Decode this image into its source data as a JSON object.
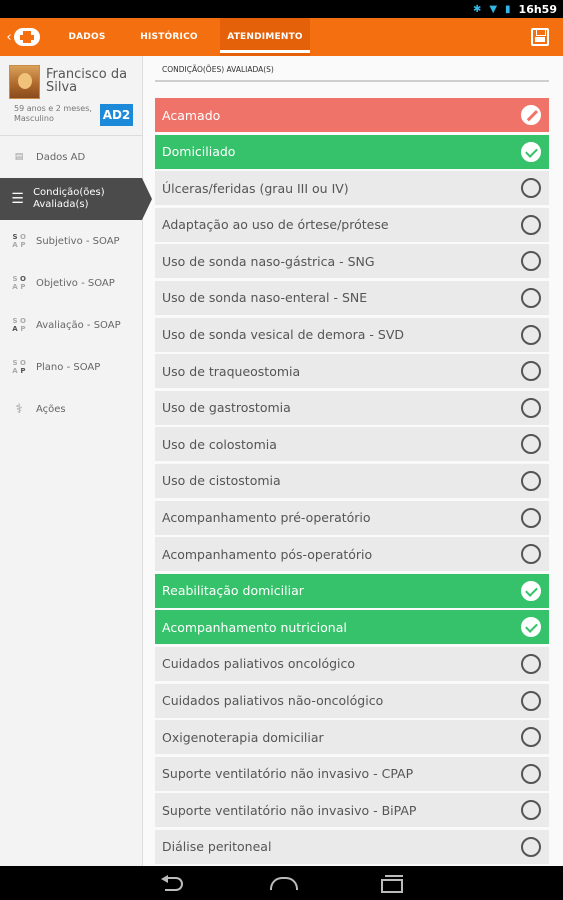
{
  "status_bar": {
    "time": "16h59"
  },
  "tabs": [
    {
      "label": "DADOS"
    },
    {
      "label": "HISTÓRICO"
    },
    {
      "label": "ATENDIMENTO"
    }
  ],
  "patient": {
    "name": "Francisco da Silva",
    "meta": "59 anos e 2 meses, Masculino",
    "badge": "AD2"
  },
  "sidebar": {
    "items": [
      {
        "label": "Dados AD",
        "icon": "id-card-icon"
      },
      {
        "label": "Condição(ões) Avaliada(s)",
        "icon": "list-icon"
      },
      {
        "label": "Subjetivo - SOAP",
        "icon": "soap-s-icon"
      },
      {
        "label": "Objetivo - SOAP",
        "icon": "soap-o-icon"
      },
      {
        "label": "Avaliação - SOAP",
        "icon": "soap-a-icon"
      },
      {
        "label": "Plano - SOAP",
        "icon": "soap-p-icon"
      },
      {
        "label": "Ações",
        "icon": "stethoscope-icon"
      }
    ]
  },
  "main": {
    "section_title": "CONDIÇÃO(ÕES) AVALIADA(S)",
    "conditions": [
      {
        "label": "Acamado",
        "state": "blocked"
      },
      {
        "label": "Domiciliado",
        "state": "checked"
      },
      {
        "label": "Úlceras/feridas (grau III ou IV)",
        "state": "unchecked"
      },
      {
        "label": "Adaptação ao uso de órtese/prótese",
        "state": "unchecked"
      },
      {
        "label": "Uso de sonda naso-gástrica - SNG",
        "state": "unchecked"
      },
      {
        "label": "Uso de sonda naso-enteral - SNE",
        "state": "unchecked"
      },
      {
        "label": "Uso de sonda vesical de demora - SVD",
        "state": "unchecked"
      },
      {
        "label": "Uso de traqueostomia",
        "state": "unchecked"
      },
      {
        "label": "Uso de gastrostomia",
        "state": "unchecked"
      },
      {
        "label": "Uso de colostomia",
        "state": "unchecked"
      },
      {
        "label": "Uso de cistostomia",
        "state": "unchecked"
      },
      {
        "label": "Acompanhamento pré-operatório",
        "state": "unchecked"
      },
      {
        "label": "Acompanhamento pós-operatório",
        "state": "unchecked"
      },
      {
        "label": "Reabilitação domiciliar",
        "state": "checked"
      },
      {
        "label": "Acompanhamento nutricional",
        "state": "checked"
      },
      {
        "label": "Cuidados paliativos oncológico",
        "state": "unchecked"
      },
      {
        "label": "Cuidados paliativos não-oncológico",
        "state": "unchecked"
      },
      {
        "label": "Oxigenoterapia domiciliar",
        "state": "unchecked"
      },
      {
        "label": "Suporte ventilatório não invasivo - CPAP",
        "state": "unchecked"
      },
      {
        "label": "Suporte ventilatório não invasivo - BiPAP",
        "state": "unchecked"
      },
      {
        "label": "Diálise peritoneal",
        "state": "unchecked"
      }
    ]
  },
  "colors": {
    "brand_orange": "#f36f0f",
    "checked_green": "#35c26a",
    "blocked_red": "#f0736a",
    "badge_blue": "#1c8ad8"
  }
}
